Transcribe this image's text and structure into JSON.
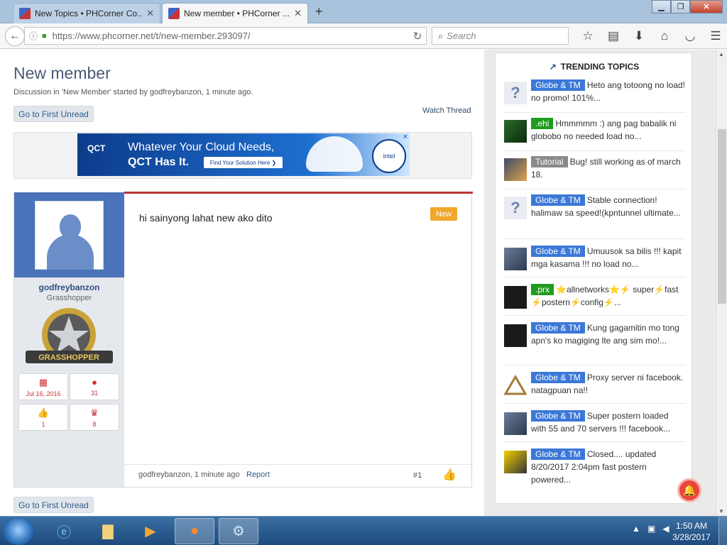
{
  "browser": {
    "tabs": [
      {
        "title": "New Topics • PHCorner Co..."
      },
      {
        "title": "New member • PHCorner ..."
      }
    ],
    "url": "https://www.phcorner.net/t/new-member.293097/",
    "search_placeholder": "Search"
  },
  "thread": {
    "title": "New member",
    "subline": "Discussion in 'New Member' started by godfreybanzon, 1 minute ago.",
    "first_unread_label": "Go to First Unread",
    "watch_label": "Watch Thread"
  },
  "ad": {
    "brand": "QCT",
    "line1": "Whatever Your Cloud Needs,",
    "line2": "QCT Has It.",
    "cta": "Find Your Solution Here ❯",
    "intel": "intel"
  },
  "post": {
    "username": "godfreybanzon",
    "rank": "Grasshopper",
    "badge_text": "GRASSHOPPER",
    "stats": {
      "joined": "Jul 16, 2016",
      "messages": "31",
      "likes": "1",
      "trophies": "8"
    },
    "text": "hi sainyong lahat new ako dito",
    "new_label": "New",
    "footer_meta": "godfreybanzon, 1 minute ago",
    "report_label": "Report",
    "number": "#1"
  },
  "trending": {
    "title": "TRENDING TOPICS",
    "items": [
      {
        "tag": "Globe & TM",
        "tag_color": "#3b78d8",
        "text": "Heto ang totoong no load! no promo! 101%..."
      },
      {
        "tag": ".ehi",
        "tag_color": "#1f9b1f",
        "text": "Hmmmmm :) ang pag babalik ni globobo no needed load no..."
      },
      {
        "tag": "Tutorial",
        "tag_color": "#8a8a8a",
        "text": "Bug! still working as of march 18."
      },
      {
        "tag": "Globe & TM",
        "tag_color": "#3b78d8",
        "text": "Stable connection! halimaw sa speed!(kpntunnel ultimate..."
      },
      {
        "tag": "Globe & TM",
        "tag_color": "#3b78d8",
        "text": "Umuusok sa bilis !!! kapit mga kasama !!! no load no..."
      },
      {
        "tag": ".prx",
        "tag_color": "#1f9b1f",
        "text": "⭐allnetworks⭐⚡ super⚡fast ⚡postern⚡config⚡..."
      },
      {
        "tag": "Globe & TM",
        "tag_color": "#3b78d8",
        "text": "Kung gagamitin mo tong apn's ko magiging lte ang sim mo!..."
      },
      {
        "tag": "Globe & TM",
        "tag_color": "#3b78d8",
        "text": "Proxy server ni facebook. natagpuan na!!"
      },
      {
        "tag": "Globe & TM",
        "tag_color": "#3b78d8",
        "text": "Super postern loaded with 55 and 70 servers !!! facebook..."
      },
      {
        "tag": "Globe & TM",
        "tag_color": "#3b78d8",
        "text": "Closed.... updated 8/20/2017 2:04pm fast postern powered..."
      }
    ]
  },
  "taskbar": {
    "time": "1:50 AM",
    "date": "3/28/2017"
  }
}
